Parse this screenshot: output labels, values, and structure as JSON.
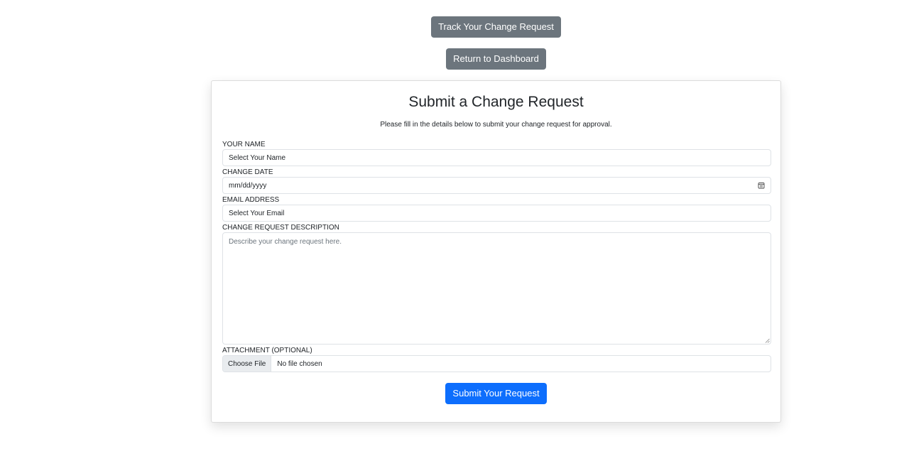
{
  "top_actions": {
    "track_label": "Track Your Change Request",
    "return_label": "Return to Dashboard"
  },
  "form": {
    "title": "Submit a Change Request",
    "subtitle": "Please fill in the details below to submit your change request for approval.",
    "name": {
      "label": "YOUR NAME",
      "placeholder": "Select Your Name"
    },
    "date": {
      "label": "CHANGE DATE",
      "placeholder": "mm/dd/yyyy"
    },
    "email": {
      "label": "EMAIL ADDRESS",
      "placeholder": "Select Your Email"
    },
    "description": {
      "label": "CHANGE REQUEST DESCRIPTION",
      "placeholder": "Describe your change request here."
    },
    "attachment": {
      "label": "ATTACHMENT (OPTIONAL)",
      "choose_label": "Choose File",
      "status": "No file chosen"
    },
    "submit_label": "Submit Your Request"
  },
  "colors": {
    "secondary": "#6c757d",
    "primary": "#0d6efd"
  },
  "icons": {
    "date": "calendar-icon",
    "textarea": "resize-handle-icon"
  }
}
